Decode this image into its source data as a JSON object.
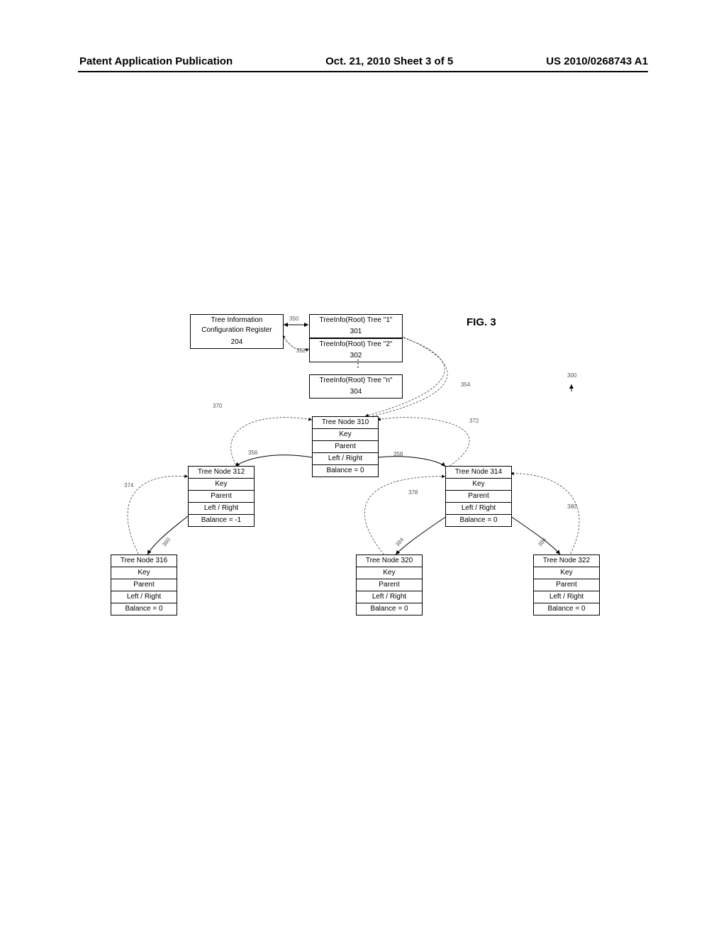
{
  "header": {
    "left": "Patent Application Publication",
    "mid": "Oct. 21, 2010   Sheet 3 of 5",
    "right": "US 2010/0268743 A1"
  },
  "figure_label": "FIG. 3",
  "config_register": {
    "line1": "Tree Information",
    "line2": "Configuration Register",
    "line3": "204"
  },
  "root_trees": {
    "tree1_line1": "TreeInfo(Root) Tree \"1\"",
    "tree1_line2": "301",
    "tree2_line1": "TreeInfo(Root) Tree \"2\"",
    "tree2_line2": "302",
    "dots": "⋮",
    "treen_line1": "TreeInfo(Root) Tree \"n\"",
    "treen_line2": "304"
  },
  "nodes": {
    "n310": {
      "title": "Tree Node 310",
      "key": "Key",
      "parent": "Parent",
      "lr": "Left / Right",
      "balance": "Balance = 0"
    },
    "n312": {
      "title": "Tree Node 312",
      "key": "Key",
      "parent": "Parent",
      "lr": "Left / Right",
      "balance": "Balance = -1"
    },
    "n314": {
      "title": "Tree Node 314",
      "key": "Key",
      "parent": "Parent",
      "lr": "Left / Right",
      "balance": "Balance = 0"
    },
    "n316": {
      "title": "Tree Node 316",
      "key": "Key",
      "parent": "Parent",
      "lr": "Left / Right",
      "balance": "Balance = 0"
    },
    "n320": {
      "title": "Tree Node 320",
      "key": "Key",
      "parent": "Parent",
      "lr": "Left / Right",
      "balance": "Balance = 0"
    },
    "n322": {
      "title": "Tree Node 322",
      "key": "Key",
      "parent": "Parent",
      "lr": "Left / Right",
      "balance": "Balance = 0"
    }
  },
  "refs": {
    "r300": "300",
    "r350": "350",
    "r352": "352",
    "r354": "354",
    "r356": "356",
    "r358": "358",
    "r360": "360",
    "r370": "370",
    "r372": "372",
    "r374": "374",
    "r378": "378",
    "r380": "380",
    "r384": "384",
    "r386": "386"
  }
}
